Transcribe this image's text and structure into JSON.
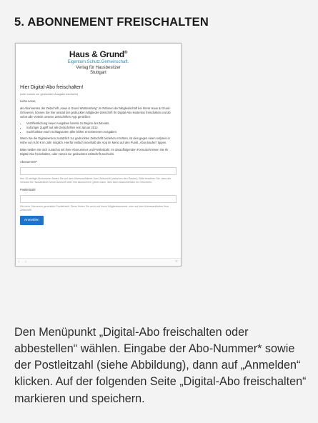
{
  "heading": "5. ABONNEMENT FREISCHALTEN",
  "screen": {
    "logo": {
      "main": "Haus & Grund",
      "mark": "®",
      "tagline": "Eigentum.Schutz.Gemeinschaft."
    },
    "verlag_line1": "Verlag für Hausbesitzer",
    "verlag_line2": "Stuttgart",
    "page_title": "Hier Digital-Abo freischalten!",
    "subtitle": "(oder zurück zur gedruckten Ausgabe wechseln)",
    "greeting": "Liebe Leser,",
    "intro": "als Abonnenten der Zeitschrift „Haus & Grund Württemberg“ im Rahmen der Mitgliedschaft bei Ihrem Haus & Grund-Ortsverein, können Sie hier anstatt der gedruckten Mitglieder-Zeitschrift Ihr Digital-Abo kostenlos freischalten und ab sofort alle Vorteile unserer Zeitschriften-App genießen:",
    "bullets": [
      "Veröffentlichung neuer Ausgaben bereits zu Beginn des Monats.",
      "Sofortiger Zugriff auf alle Zeitschriften seit Januar 2012.",
      "Suchfunktion nach Schlagworten aller bisher erschienenen Ausgaben."
    ],
    "paragraph2": "Wenn Sie die Digitalversion zusätzlich zur gedruckten Zeitschrift beziehen möchten, ist dies gegen einen Aufpreis in Höhe von 9,00 € im Jahr möglich. Hierfür einfach innerhalb der App im Menü auf den Punkt „Abos kaufen“ tippen.",
    "paragraph3": "Bitte melden Sie sich zunächst mit Ihrer Abonummer und Postleitzahl. Im darauffolgenden Formular können Sie Ihr Digital-Abo freischalten, oder zurück zur gedruckten Zeitschrift wechseln.",
    "abonummer_label": "Abonummer*",
    "abonummer_value": "",
    "abonummer_hint": "Ihre 10-stellige Abonummer finden Sie auf dem Adressaufkleber Ihrer Zeitschrift (zwischen den Rauten). Bitte beachten Sie, dass der Versand für Hausbesitzer keine Auskunft über Ihre Abonummer geben kann, dies kann ausschließlich Ihr Ortsverein.",
    "plz_label": "Postleitzahl",
    "plz_value": "",
    "plz_hint": "Die beim Ortsverein gemeldete Postleitzahl. Diese finden Sie auch auf Ihrem Mitgliedsausweis, oder auf dem Adressaufkleber Ihrer Zeitschrift.",
    "login_button": "Anmelden",
    "nav": {
      "back": "‹",
      "forward": "›",
      "close": "×"
    }
  },
  "instructions": "Den Menüpunkt „Digital-Abo freischalten oder abbestellen“ wählen. Eingabe der Abo-Nummer* sowie der Postleitzahl (siehe Abbildung), dann auf „Anmelden“ klicken. Auf der folgenden Seite „Digital-Abo freischalten“ markieren und speichern."
}
